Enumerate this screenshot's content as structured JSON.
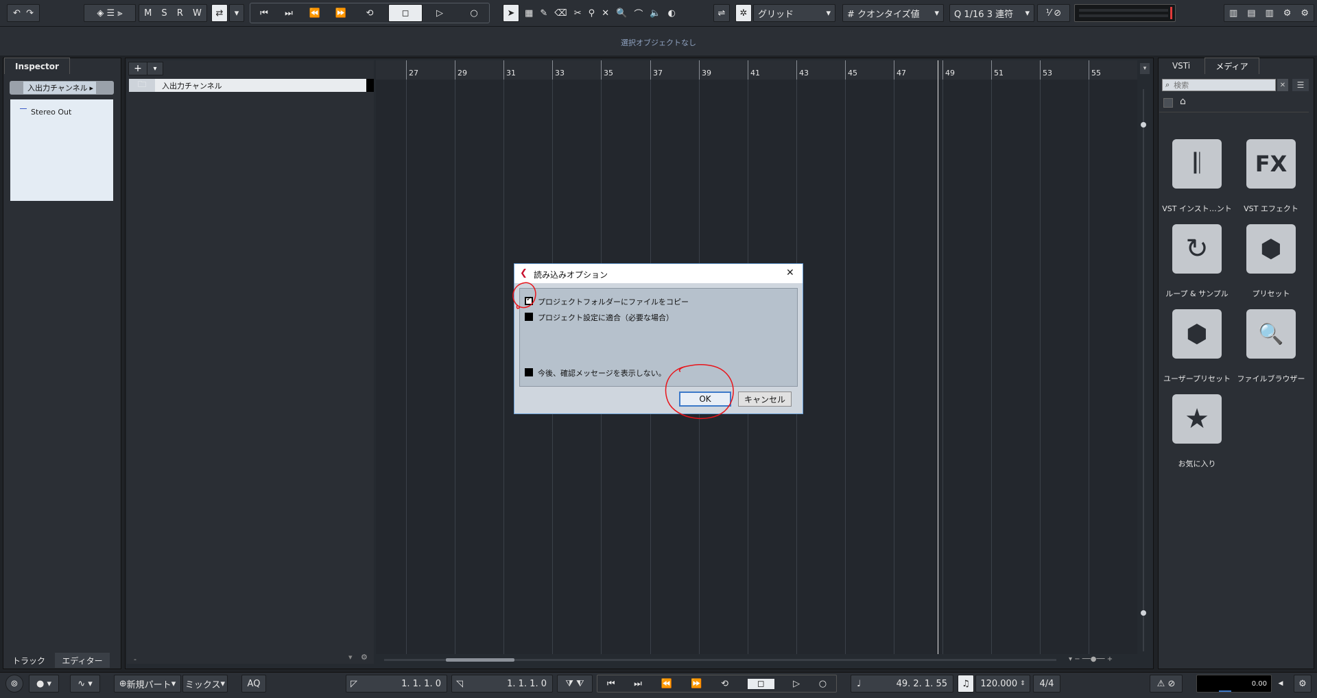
{
  "toolbar": {
    "msrw": [
      "M",
      "S",
      "R",
      "W"
    ],
    "snap_type": "グリッド",
    "quantize_label": "クオンタイズ値",
    "quantize_value": "1/16 3 連符"
  },
  "infoline": {
    "text": "選択オブジェクトなし"
  },
  "inspector": {
    "tab": "Inspector",
    "header": "入出力チャンネル",
    "item": "Stereo Out",
    "bottom_tabs": [
      "トラック",
      "エディター"
    ]
  },
  "project": {
    "add_button": "+",
    "track_name": "入出力チャンネル",
    "ruler_numbers": [
      "27",
      "29",
      "31",
      "33",
      "35",
      "37",
      "39",
      "41",
      "43",
      "45",
      "47",
      "49",
      "51",
      "53",
      "55"
    ],
    "bottom_left_label": "-"
  },
  "right_zone": {
    "tabs": [
      "VSTi",
      "メディア"
    ],
    "search_placeholder": "検索",
    "tiles": [
      {
        "icon": "piano-icon",
        "glyph": "𝄃",
        "label": "VST インスト…ント"
      },
      {
        "icon": "fx-icon",
        "glyph": "FX",
        "label": "VST エフェクト"
      },
      {
        "icon": "loop-icon",
        "glyph": "↻",
        "label": "ループ & サンプル"
      },
      {
        "icon": "preset-icon",
        "glyph": "⬢",
        "label": "プリセット"
      },
      {
        "icon": "user-preset-icon",
        "glyph": "⬢",
        "label": "ユーザープリセット"
      },
      {
        "icon": "file-browser-icon",
        "glyph": "🔍",
        "label": "ファイルブラウザー"
      },
      {
        "icon": "favorites-icon",
        "glyph": "★",
        "label": "お気に入り"
      }
    ]
  },
  "bottombar": {
    "new_part": "新規パート",
    "mix": "ミックス",
    "aq": "AQ",
    "left_locator": "1. 1. 1.    0",
    "right_locator": "1. 1. 1.    0",
    "position": "49. 2. 1. 55",
    "tempo": "120.000",
    "signature": "4/4",
    "level": "0.00"
  },
  "dialog": {
    "title": "読み込みオプション",
    "options": [
      {
        "label": "プロジェクトフォルダーにファイルをコピー",
        "checked": true
      },
      {
        "label": "プロジェクト設定に適合（必要な場合）",
        "checked": false
      }
    ],
    "dont_show": "今後、確認メッセージを表示しない。",
    "ok": "OK",
    "cancel": "キャンセル",
    "close": "✕"
  },
  "colors": {
    "annotation": "#e8141a",
    "accent": "#3b78c8"
  }
}
